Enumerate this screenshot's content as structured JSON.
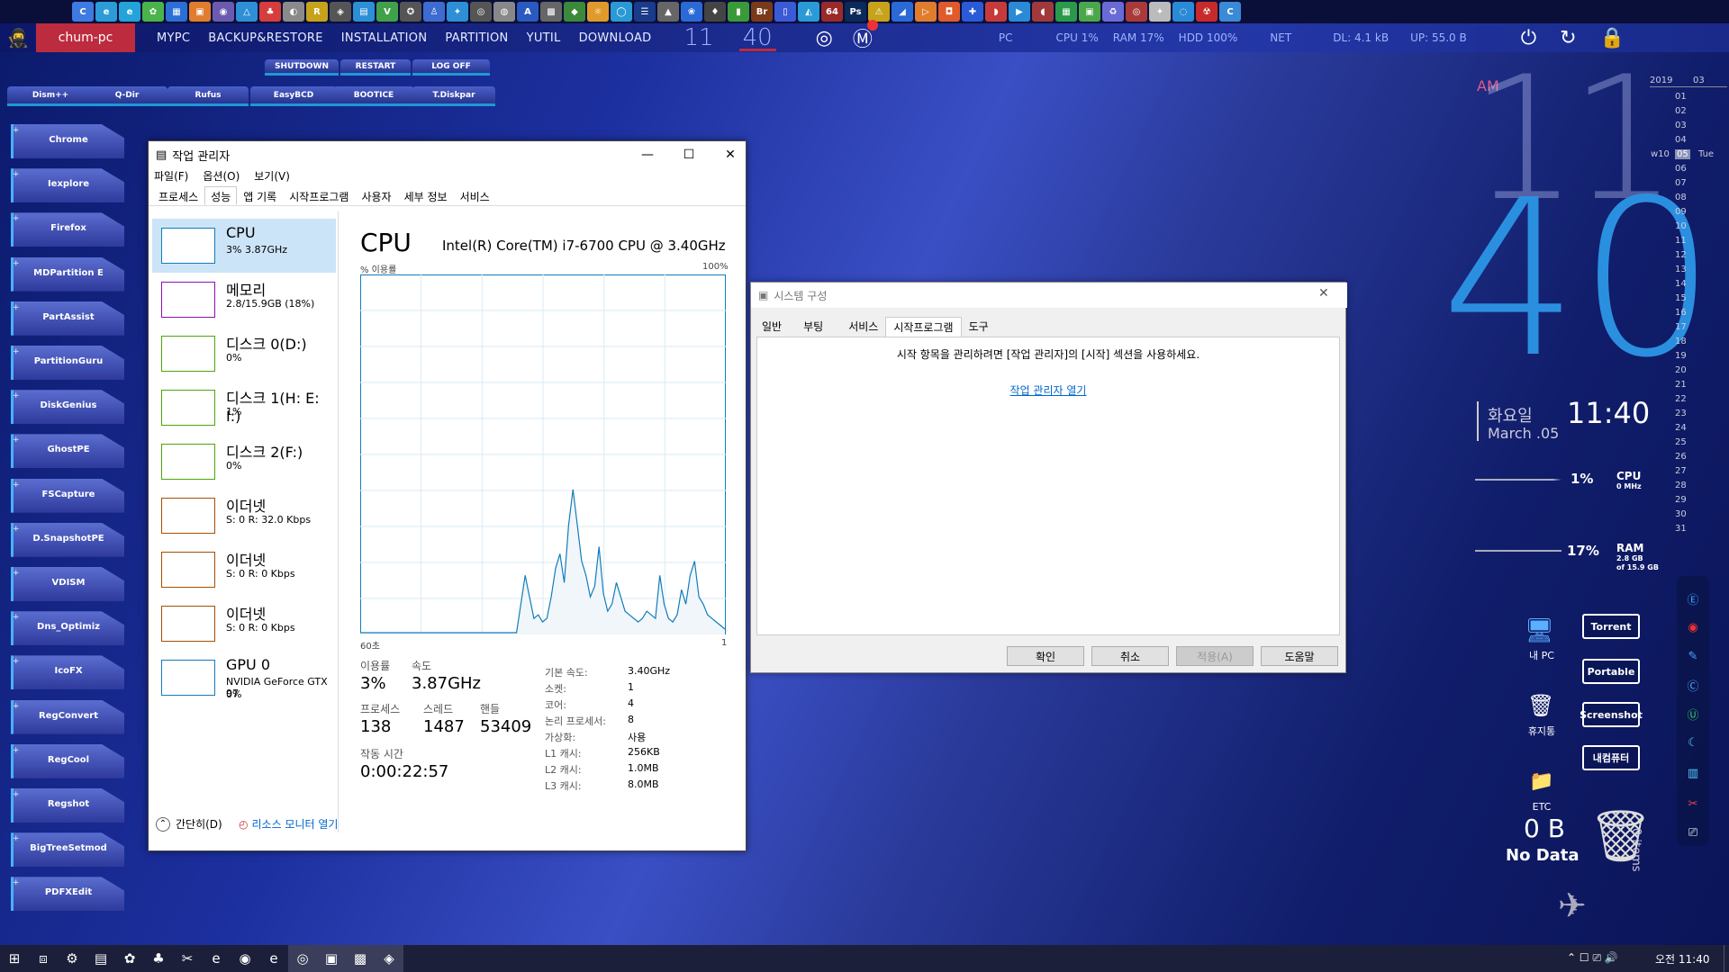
{
  "top_icons": [
    "C",
    "e",
    "e",
    "✿",
    "▦",
    "▣",
    "◉",
    "△",
    "♣",
    "◐",
    "R",
    "◈",
    "▤",
    "V",
    "✪",
    "♙",
    "✦",
    "◎",
    "◍",
    "A",
    "▩",
    "◆",
    "☼",
    "◯",
    "☰",
    "▲",
    "❀",
    "♦",
    "▮",
    "Br",
    "▯",
    "◭",
    "64",
    "Ps",
    "⚠",
    "◢",
    "▷",
    "◘",
    "✚",
    "◗",
    "▶",
    "◖",
    "▦",
    "▣",
    "♻",
    "◎",
    "✦",
    "◌",
    "☢",
    "C"
  ],
  "menubar": {
    "hostname": "chum-pc",
    "items": [
      "MYPC",
      "BACKUP&RESTORE",
      "INSTALLATION",
      "PARTITION",
      "YUTIL",
      "DOWNLOAD"
    ],
    "hour": "11",
    "minute": "40",
    "pc_label": "PC",
    "cpu": "CPU  1%",
    "ram": "RAM  17%",
    "hdd": "HDD  100%",
    "net": "NET",
    "dl": "DL:  4.1 kB",
    "up": "UP:  55.0 B"
  },
  "power_menu": [
    "SHUTDOWN",
    "RESTART",
    "LOG OFF"
  ],
  "launch_tabs": [
    "Dism++",
    "Q-Dir",
    "Rufus",
    "EasyBCD",
    "BOOTICE",
    "T.Diskpar"
  ],
  "side_buttons": [
    "Chrome",
    "Iexplore",
    "Firefox",
    "MDPartition E",
    "PartAssist",
    "PartitionGuru",
    "DiskGenius",
    "GhostPE",
    "FSCapture",
    "D.SnapshotPE",
    "VDISM",
    "Dns_Optimiz",
    "IcoFX",
    "RegConvert",
    "RegCool",
    "Regshot",
    "BigTreeSetmod",
    "PDFXEdit"
  ],
  "task_manager": {
    "title": "작업 관리자",
    "menus": [
      "파일(F)",
      "옵션(O)",
      "보기(V)"
    ],
    "tabs": [
      "프로세스",
      "성능",
      "앱 기록",
      "시작프로그램",
      "사용자",
      "세부 정보",
      "서비스"
    ],
    "perf_items": [
      {
        "name": "CPU",
        "value": "3% 3.87GHz"
      },
      {
        "name": "메모리",
        "value": "2.8/15.9GB (18%)"
      },
      {
        "name": "디스크 0(D:)",
        "value": "0%"
      },
      {
        "name": "디스크 1(H: E: I:)",
        "value": "1%"
      },
      {
        "name": "디스크 2(F:)",
        "value": "0%"
      },
      {
        "name": "이더넷",
        "value": "S: 0 R: 32.0 Kbps"
      },
      {
        "name": "이더넷",
        "value": "S: 0 R: 0 Kbps"
      },
      {
        "name": "이더넷",
        "value": "S: 0 R: 0 Kbps"
      },
      {
        "name": "GPU 0",
        "value": "NVIDIA GeForce GTX 97",
        "value2": "0%"
      }
    ],
    "cpu_title": "CPU",
    "cpu_model": "Intel(R) Core(TM) i7-6700 CPU @ 3.40GHz",
    "graph_ylabel": "% 이용률",
    "graph_ymax": "100%",
    "graph_xleft": "60초",
    "graph_xright": "1",
    "usage_label": "이용률",
    "usage_value": "3%",
    "speed_label": "속도",
    "speed_value": "3.87GHz",
    "proc_label": "프로세스",
    "proc_value": "138",
    "thread_label": "스레드",
    "thread_value": "1487",
    "handle_label": "핸들",
    "handle_value": "53409",
    "uptime_label": "작동 시간",
    "uptime_value": "0:00:22:57",
    "specs": [
      {
        "k": "기본 속도:",
        "v": "3.40GHz"
      },
      {
        "k": "소켓:",
        "v": "1"
      },
      {
        "k": "코어:",
        "v": "4"
      },
      {
        "k": "논리 프로세서:",
        "v": "8"
      },
      {
        "k": "가상화:",
        "v": "사용"
      },
      {
        "k": "L1 캐시:",
        "v": "256KB"
      },
      {
        "k": "L2 캐시:",
        "v": "1.0MB"
      },
      {
        "k": "L3 캐시:",
        "v": "8.0MB"
      }
    ],
    "fewer_details": "간단히(D)",
    "resource_monitor": "리소스 모니터 열기"
  },
  "cpu_graph": [
    0,
    0,
    0,
    0,
    0,
    0,
    0,
    0,
    0,
    0,
    0,
    0,
    0,
    0,
    0,
    0,
    0,
    0,
    0,
    0,
    0,
    0,
    0,
    0,
    0,
    0,
    0,
    0,
    0,
    0,
    0,
    0,
    0,
    0,
    0,
    0,
    0,
    8,
    16,
    10,
    4,
    5,
    3,
    4,
    10,
    18,
    22,
    14,
    30,
    40,
    30,
    20,
    16,
    10,
    13,
    24,
    11,
    6,
    8,
    14,
    10,
    6,
    5,
    4,
    3,
    4,
    6,
    5,
    4,
    16,
    8,
    4,
    3,
    5,
    12,
    8,
    16,
    20,
    10,
    8,
    5,
    4,
    3,
    2,
    1
  ],
  "system_config": {
    "title": "시스템 구성",
    "tabs": [
      "일반",
      "부팅",
      "서비스",
      "시작프로그램",
      "도구"
    ],
    "message": "시작 항목을 관리하려면 [작업 관리자]의 [시작] 섹션을 사용하세요.",
    "link": "작업 관리자 열기",
    "buttons": [
      "확인",
      "취소",
      "적용(A)",
      "도움말"
    ]
  },
  "clock": {
    "ampm": "AM",
    "hour": "11",
    "minute": "40",
    "weekday": "화요일",
    "date": "March .05",
    "time": "11:40",
    "cpu_pct": "1%",
    "cpu_label": "CPU",
    "cpu_sub": "0 MHz",
    "ram_pct": "17%",
    "ram_label": "RAM",
    "ram_sub1": "2.8 GB",
    "ram_sub2": "of 15.9 GB"
  },
  "calendar": {
    "year": "2019",
    "month": "03",
    "week": "w10",
    "today": "05",
    "today_day": "Tue",
    "days": [
      "01",
      "02",
      "03",
      "04",
      "05",
      "06",
      "07",
      "08",
      "09",
      "10",
      "11",
      "12",
      "13",
      "14",
      "15",
      "16",
      "17",
      "18",
      "19",
      "20",
      "21",
      "22",
      "23",
      "24",
      "25",
      "26",
      "27",
      "28",
      "29",
      "30",
      "31"
    ]
  },
  "desktop": {
    "mypc": "내 PC",
    "recycle": "휴지통",
    "etc": "ETC",
    "buttons": [
      "Torrent",
      "Portable",
      "Screenshot",
      "내컴퓨터"
    ],
    "bin_size": "0 B",
    "bin_status": "No Data",
    "bin_items": "0 items"
  },
  "taskbar": {
    "icons": [
      "⊞",
      "⧈",
      "⚙",
      "▤",
      "✿",
      "♣",
      "✂",
      "e",
      "◉",
      "e",
      "◎",
      "▣",
      "▩",
      "◈"
    ],
    "time": "오전 11:40"
  },
  "colors": {
    "accent_red": "#bd2b3e",
    "clock_blue": "#2b8fe0",
    "tm_graph": "#117dbb"
  }
}
